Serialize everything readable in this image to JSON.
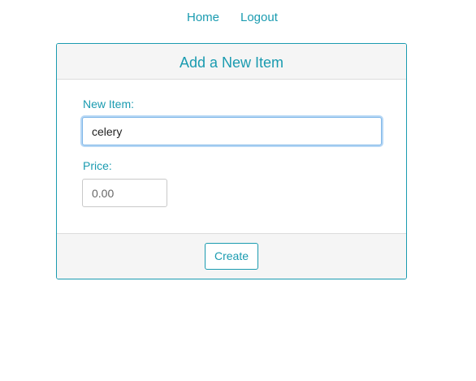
{
  "nav": {
    "home_label": "Home",
    "logout_label": "Logout"
  },
  "form": {
    "title": "Add a New Item",
    "item_label": "New Item:",
    "item_value": "celery",
    "price_label": "Price:",
    "price_placeholder": "0.00",
    "submit_label": "Create"
  },
  "colors": {
    "accent": "#1a9bb0",
    "panel_background": "#f5f5f5",
    "focus_ring": "#b6d7f5"
  }
}
